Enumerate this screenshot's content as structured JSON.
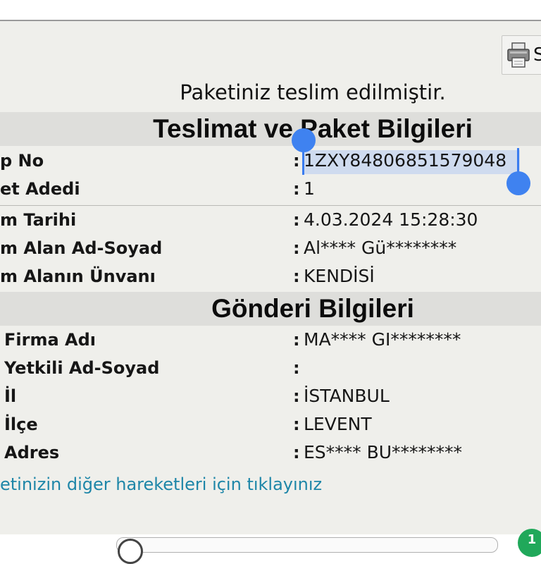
{
  "print_button": {
    "label": "S",
    "icon": "printer-icon"
  },
  "status_message": "Paketiniz teslim edilmiştir.",
  "delivery_section": {
    "title": "Teslimat ve Paket Bilgileri",
    "rows": [
      {
        "label": "p No",
        "value": "1ZXY84806851579048"
      },
      {
        "label": "et Adedi",
        "value": "1"
      },
      {
        "label": "m Tarihi",
        "value": "4.03.2024 15:28:30"
      },
      {
        "label": "m Alan Ad-Soyad",
        "value": "Al**** Gü********"
      },
      {
        "label": "m Alanın Ünvanı",
        "value": "KENDİSİ"
      }
    ]
  },
  "sender_section": {
    "title": "Gönderi Bilgileri",
    "rows": [
      {
        "label": "Firma Adı",
        "value": "MA**** GI********"
      },
      {
        "label": "Yetkili Ad-Soyad",
        "value": ""
      },
      {
        "label": "İl",
        "value": "İSTANBUL"
      },
      {
        "label": "İlçe",
        "value": "LEVENT"
      },
      {
        "label": "Adres",
        "value": "ES**** BU********"
      }
    ]
  },
  "colon": ":",
  "other_movements_link": "etinizin diğer hareketleri için tıklayınız",
  "badge_count": "1",
  "colors": {
    "panel_bg": "#efefeb",
    "section_bg": "#dededb",
    "link": "#1e86a8",
    "selection": "#3f82f0"
  }
}
